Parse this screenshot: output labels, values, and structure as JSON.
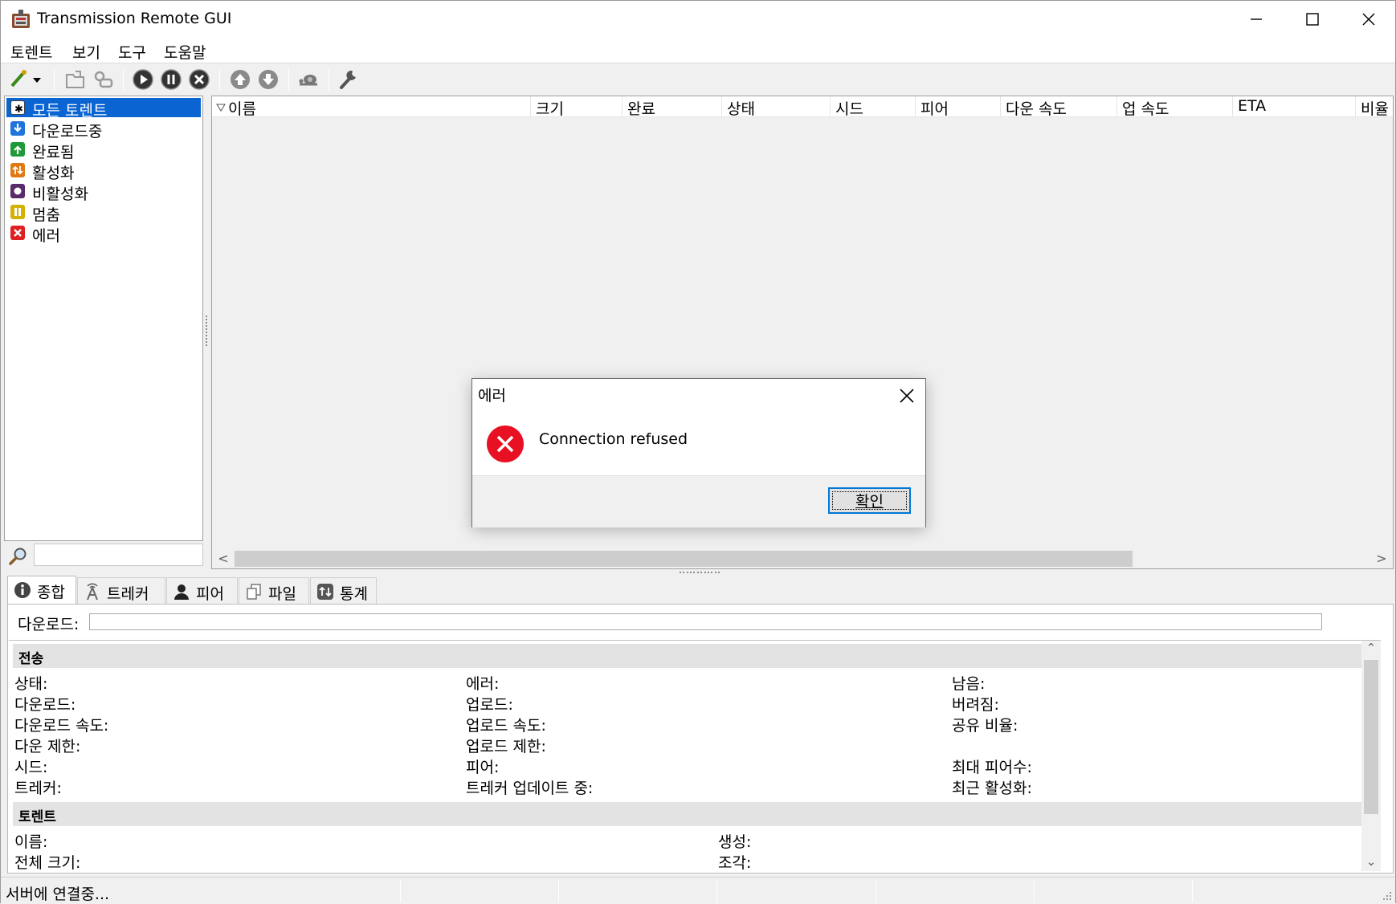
{
  "window": {
    "title": "Transmission Remote GUI"
  },
  "menu": {
    "items": [
      "토렌트",
      "보기",
      "도구",
      "도움말"
    ]
  },
  "filters": {
    "items": [
      {
        "label": "모든 토렌트",
        "icon": "all-torrents-icon",
        "selected": true
      },
      {
        "label": "다운로드중",
        "icon": "downloading-icon"
      },
      {
        "label": "완료됨",
        "icon": "completed-icon"
      },
      {
        "label": "활성화",
        "icon": "active-icon"
      },
      {
        "label": "비활성화",
        "icon": "inactive-icon"
      },
      {
        "label": "멈춤",
        "icon": "paused-icon"
      },
      {
        "label": "에러",
        "icon": "error-icon"
      }
    ],
    "search_value": ""
  },
  "list": {
    "columns": [
      "이름",
      "크기",
      "완료",
      "상태",
      "시드",
      "피어",
      "다운 속도",
      "업 속도",
      "ETA",
      "비율"
    ]
  },
  "tabs": {
    "items": [
      {
        "label": "종합",
        "icon": "info-icon",
        "active": true
      },
      {
        "label": "트레커",
        "icon": "tracker-icon"
      },
      {
        "label": "피어",
        "icon": "peer-icon"
      },
      {
        "label": "파일",
        "icon": "files-icon"
      },
      {
        "label": "통계",
        "icon": "stats-icon"
      }
    ]
  },
  "general": {
    "download_label": "다운로드:",
    "sections": {
      "transfer": "전송",
      "torrent": "토렌트"
    },
    "transfer_fields": {
      "col1": [
        "상태:",
        "다운로드:",
        "다운로드 속도:",
        "다운 제한:",
        "시드:",
        "트레커:"
      ],
      "col2": [
        "에러:",
        "업로드:",
        "업로드 속도:",
        "업로드 제한:",
        "피어:",
        "트레커 업데이트 중:"
      ],
      "col3": [
        "남음:",
        "버려짐:",
        "공유 비율:",
        "",
        "최대 피어수:",
        "최근 활성화:"
      ]
    },
    "torrent_fields": {
      "col1": [
        "이름:",
        "전체 크기:"
      ],
      "col2": [
        "생성:",
        "조각:"
      ]
    }
  },
  "status": {
    "text": "서버에 연결중..."
  },
  "dialog": {
    "title": "에러",
    "message": "Connection refused",
    "ok_label": "확인"
  },
  "colors": {
    "selection": "#0a64d2",
    "error_red": "#e81123",
    "ok_focus": "#0078d7"
  }
}
